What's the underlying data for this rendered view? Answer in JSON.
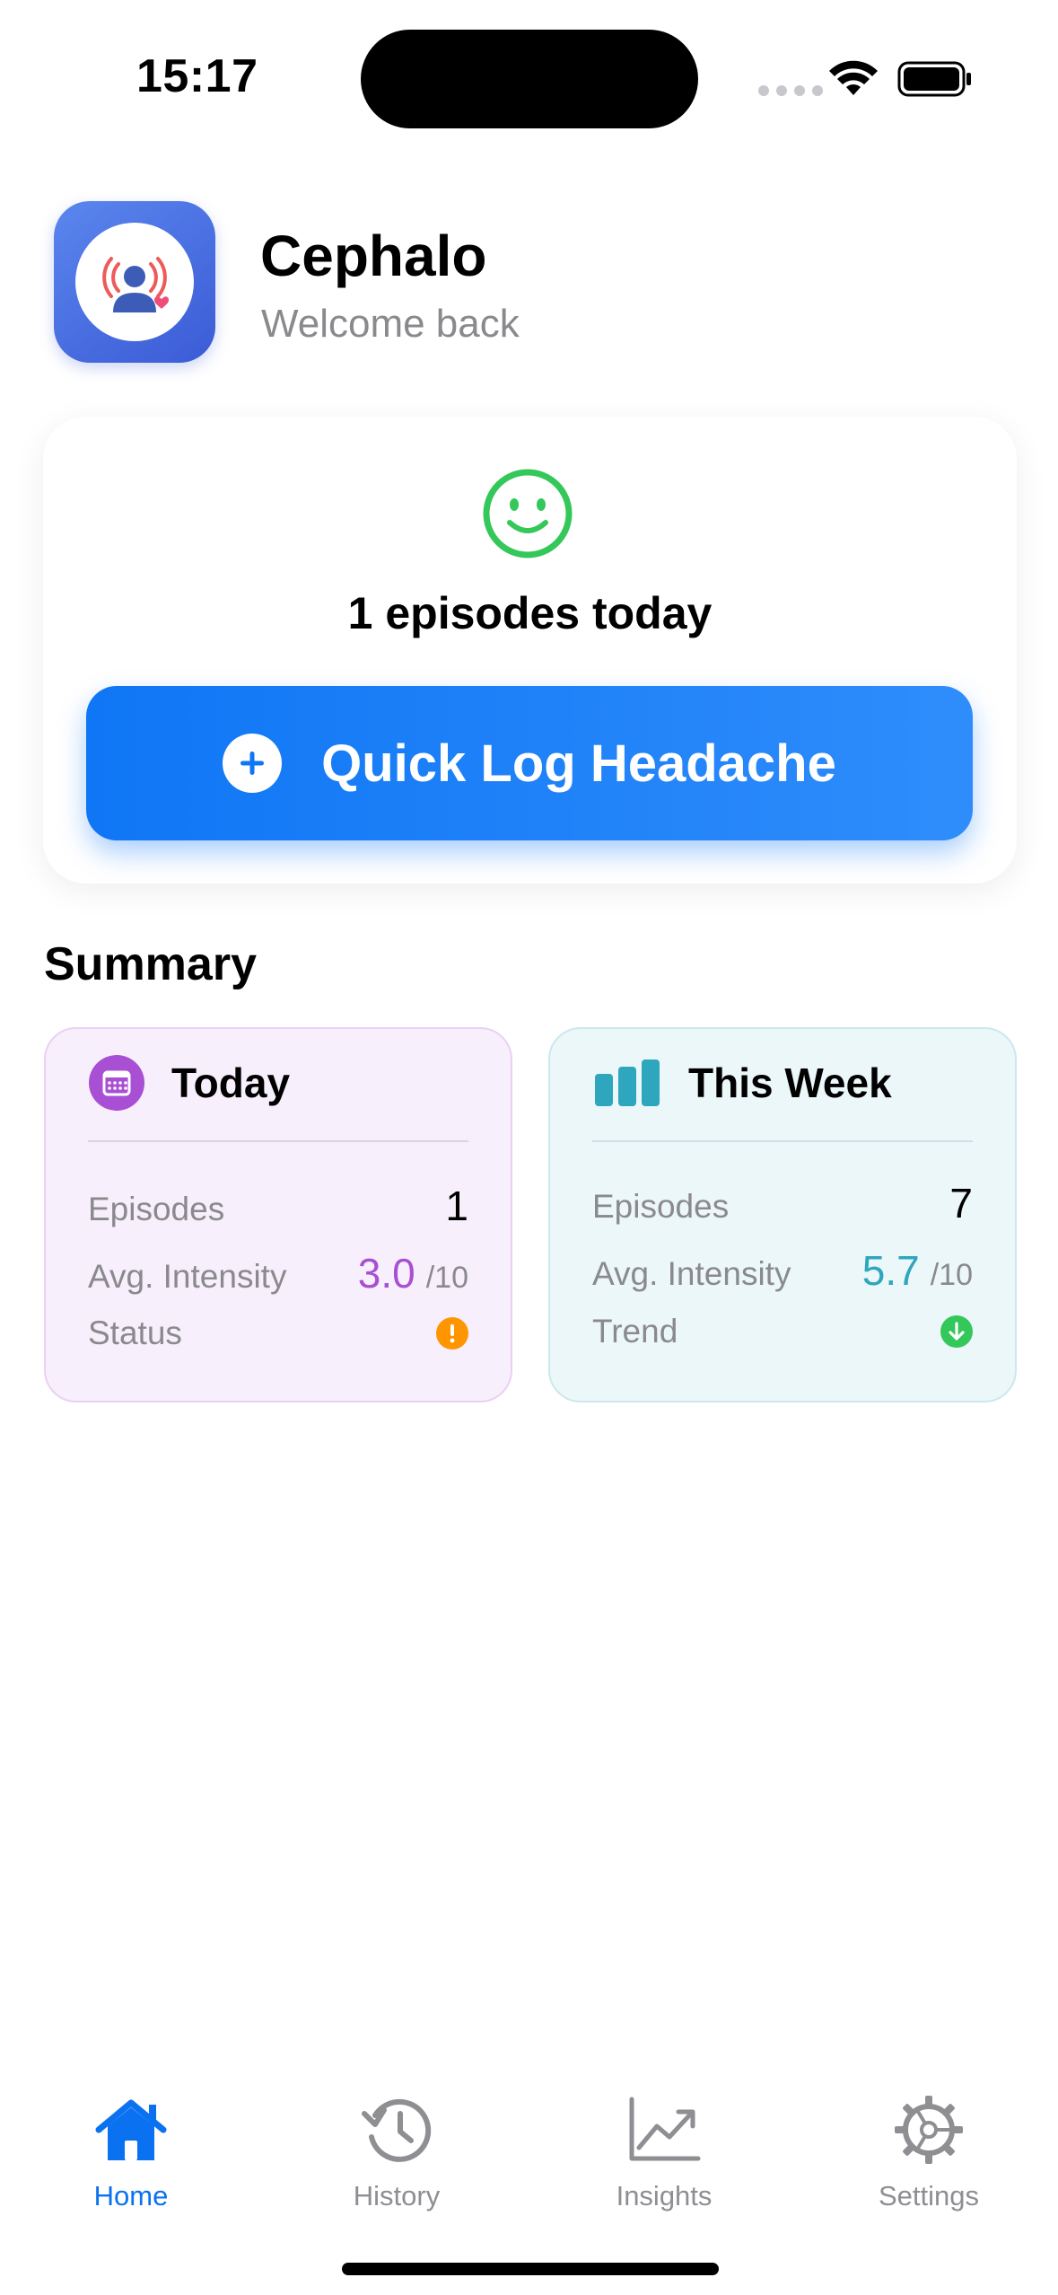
{
  "status_bar": {
    "time": "15:17"
  },
  "header": {
    "app_name": "Cephalo",
    "subtitle": "Welcome back"
  },
  "hero": {
    "episodes_today_text": "1 episodes today",
    "quick_log_label": "Quick Log Headache",
    "icon": "smiley-face-icon"
  },
  "summary": {
    "heading": "Summary",
    "today": {
      "title": "Today",
      "icon": "calendar-icon",
      "episodes_label": "Episodes",
      "episodes_value": "1",
      "intensity_label": "Avg. Intensity",
      "intensity_value": "3.0",
      "intensity_max": "/10",
      "status_label": "Status",
      "status_icon": "warning-icon"
    },
    "week": {
      "title": "This Week",
      "icon": "bar-chart-icon",
      "episodes_label": "Episodes",
      "episodes_value": "7",
      "intensity_label": "Avg. Intensity",
      "intensity_value": "5.7",
      "intensity_max": "/10",
      "trend_label": "Trend",
      "trend_icon": "arrow-down-icon"
    }
  },
  "tab_bar": {
    "active": "Home",
    "tabs": [
      {
        "label": "Home",
        "icon": "house-icon"
      },
      {
        "label": "History",
        "icon": "history-icon"
      },
      {
        "label": "Insights",
        "icon": "chart-line-icon"
      },
      {
        "label": "Settings",
        "icon": "gear-icon"
      }
    ]
  },
  "colors": {
    "accent_blue": "#0a72f0",
    "today_accent": "#a94fd3",
    "week_accent": "#2ea6bd",
    "success_green": "#34c759",
    "warning_orange": "#ff9500"
  }
}
